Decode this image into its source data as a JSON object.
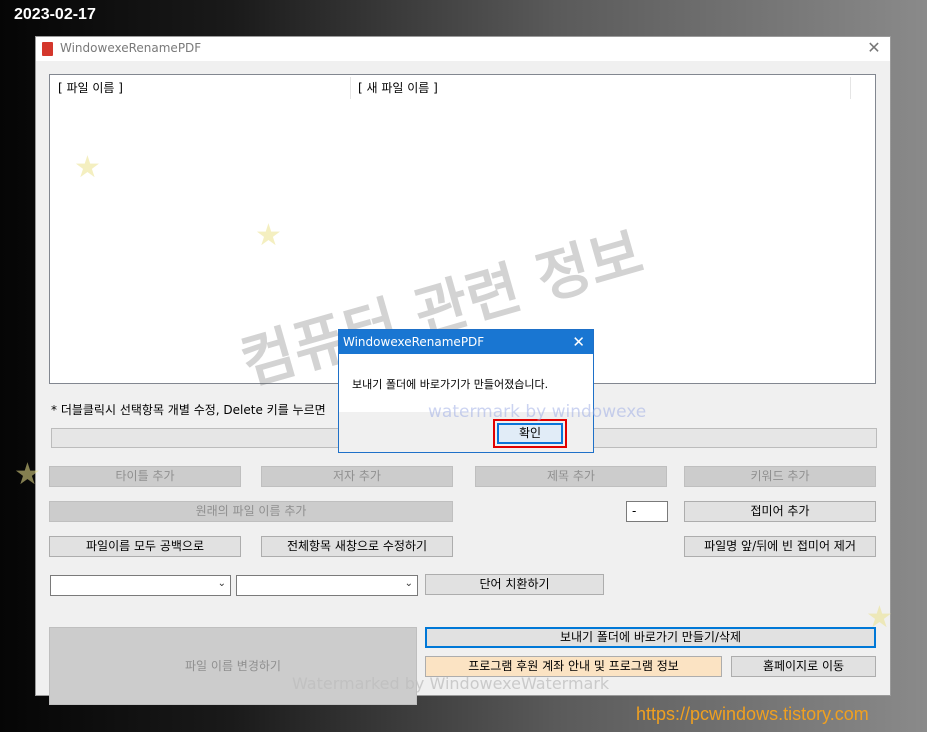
{
  "overlay": {
    "date": "2023-02-17",
    "site": "https://pcwindows.tistory.com",
    "watermark_main": "Watermarked by WindowexeWatermark",
    "watermark_dialog": "watermark by windowexe",
    "korean_watermark": "컴퓨터 관련 정보"
  },
  "window": {
    "title": "WindowexeRenamePDF",
    "icon": "pdf-icon",
    "close_glyph": "✕"
  },
  "list": {
    "col_original": "[ 파일 이름 ]",
    "col_new": "[ 새 파일 이름 ]"
  },
  "hint": "* 더블클릭시 선택항목 개별 수정, Delete 키를 누르면",
  "buttons": {
    "add_title": "타이틀 추가",
    "add_author": "저자 추가",
    "add_subject": "제목 추가",
    "add_keyword": "키워드 추가",
    "add_original_name": "원래의 파일 이름 추가",
    "add_affix": "접미어 추가",
    "all_blank": "파일이름 모두 공백으로",
    "edit_all": "전체항목 새창으로 수정하기",
    "remove_empty_affix": "파일명 앞/뒤에 빈 접미어 제거",
    "replace_word": "단어 치환하기",
    "rename_files": "파일 이름 변경하기",
    "sendto_shortcut": "보내기 폴더에 바로가기 만들기/삭제",
    "support_info": "프로그램 후원 계좌 안내 및 프로그램 정보",
    "homepage": "홈페이지로 이동"
  },
  "affix_value": "-",
  "dialog": {
    "title": "WindowexeRenamePDF",
    "close_glyph": "✕",
    "message": "보내기 폴더에 바로가기가 만들어졌습니다.",
    "ok_label": "확인"
  },
  "colors": {
    "dialog_accent": "#1976d2",
    "highlight_box": "#e10000",
    "link": "#f0a020"
  }
}
